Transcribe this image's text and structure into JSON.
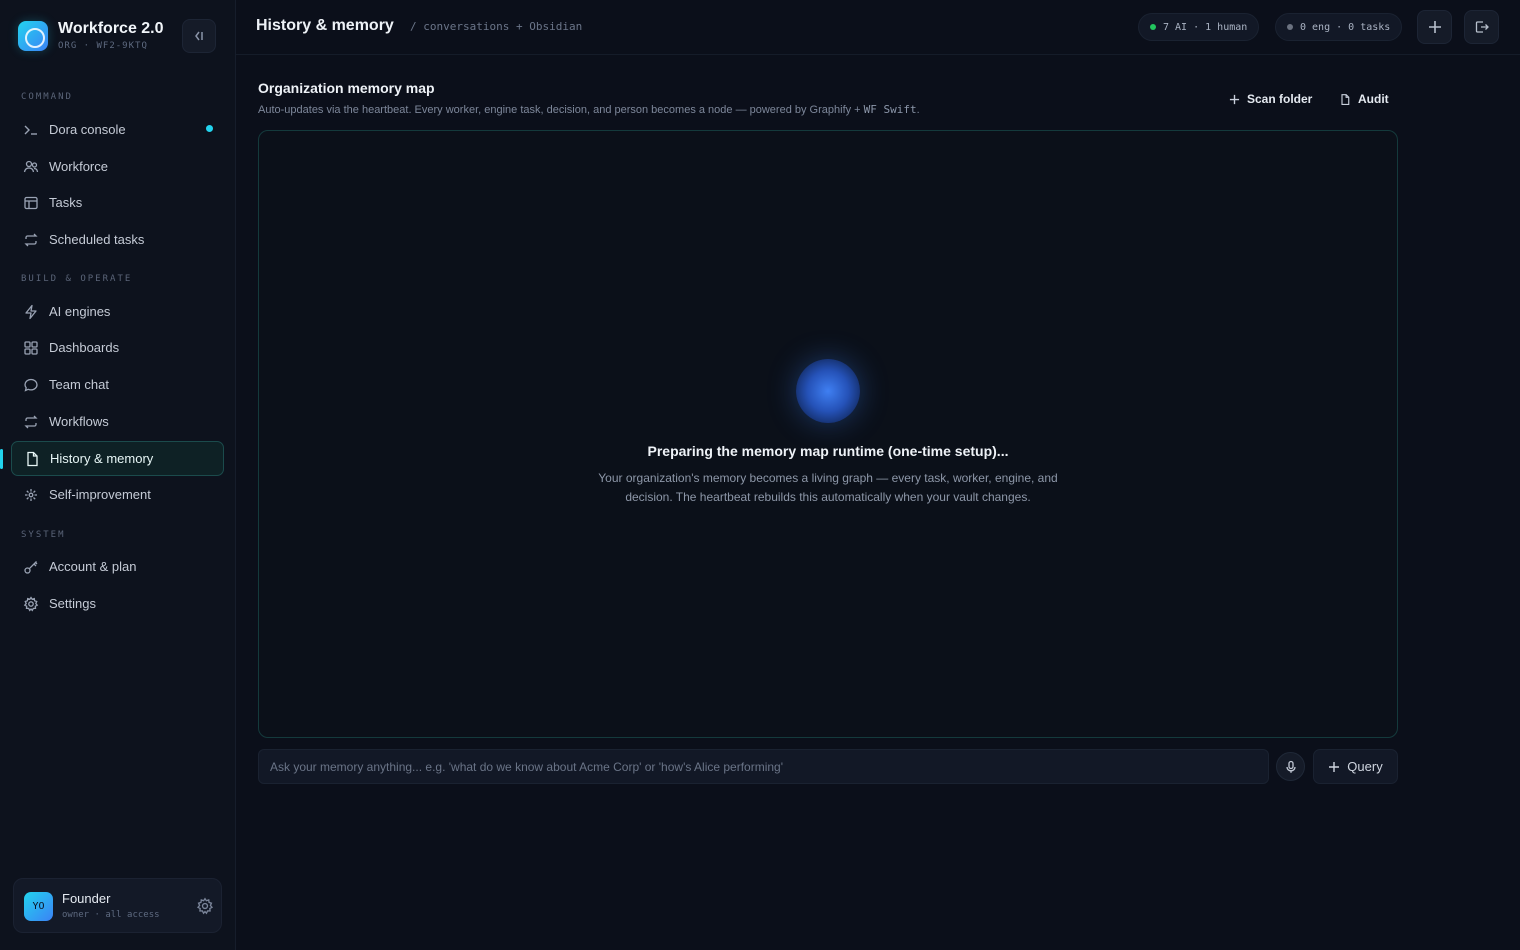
{
  "app": {
    "name": "Workforce 2.0",
    "org": "ORG · WF2-9KTQ"
  },
  "sidebar": {
    "sections": [
      {
        "label": "COMMAND"
      },
      {
        "label": "BUILD & OPERATE"
      },
      {
        "label": "SYSTEM"
      }
    ],
    "items": [
      {
        "label": "Dora console",
        "icon": "terminal-icon"
      },
      {
        "label": "Workforce",
        "icon": "users-icon"
      },
      {
        "label": "Tasks",
        "icon": "table-icon"
      },
      {
        "label": "Scheduled tasks",
        "icon": "repeat-icon"
      },
      {
        "label": "AI engines",
        "icon": "bolt-icon"
      },
      {
        "label": "Dashboards",
        "icon": "grid-icon"
      },
      {
        "label": "Team chat",
        "icon": "chat-icon"
      },
      {
        "label": "Workflows",
        "icon": "repeat-icon"
      },
      {
        "label": "History & memory",
        "icon": "file-icon",
        "active": true
      },
      {
        "label": "Self-improvement",
        "icon": "sparkle-icon"
      },
      {
        "label": "Account & plan",
        "icon": "key-icon"
      },
      {
        "label": "Settings",
        "icon": "gear-icon"
      }
    ]
  },
  "user": {
    "initials": "YO",
    "name": "Founder",
    "role": "owner · all access"
  },
  "header": {
    "title": "History & memory",
    "breadcrumb": "/ conversations + Obsidian",
    "status_workers": "7 AI · 1 human",
    "status_engines": "0 eng · 0 tasks"
  },
  "main": {
    "title": "Organization memory map",
    "description": "Auto-updates via the heartbeat. Every worker, engine task, decision, and person becomes a node — powered by Graphify + ",
    "description_code": "WF Swift",
    "description_end": ".",
    "scan_folder_label": "Scan folder",
    "audit_label": "Audit",
    "preparing_title": "Preparing the memory map runtime (one-time setup)...",
    "preparing_text": "Your organization's memory becomes a living graph — every task, worker, engine, and decision. The heartbeat rebuilds this automatically when your vault changes.",
    "query_placeholder": "Ask your memory anything... e.g. 'what do we know about Acme Corp' or 'how's Alice performing'",
    "query_label": "Query"
  },
  "colors": {
    "accent": "#22d3ee",
    "background": "#0b0f1a",
    "status_green": "#22c55e",
    "status_gray": "#6b7280"
  }
}
